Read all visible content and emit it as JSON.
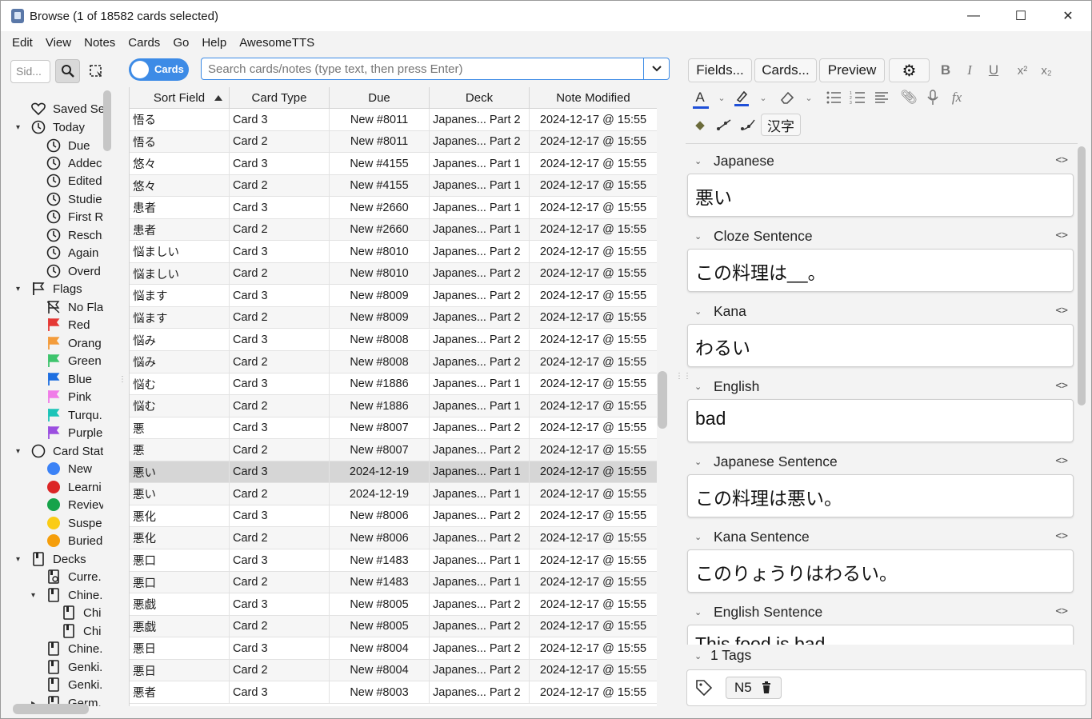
{
  "window": {
    "title": "Browse (1 of 18582 cards selected)",
    "minimize": "—",
    "maximize": "☐",
    "close": "✕"
  },
  "menu": [
    "Edit",
    "View",
    "Notes",
    "Cards",
    "Go",
    "Help",
    "AwesomeTTS"
  ],
  "sidebar": {
    "search_placeholder": "Sid...",
    "items": [
      {
        "label": "Saved Se",
        "icon": "heart-icon"
      },
      {
        "label": "Today",
        "icon": "clock-icon"
      },
      {
        "label": "Due",
        "icon": "clock-icon"
      },
      {
        "label": "Addec",
        "icon": "clock-icon"
      },
      {
        "label": "Edited",
        "icon": "clock-icon"
      },
      {
        "label": "Studie",
        "icon": "clock-icon"
      },
      {
        "label": "First R",
        "icon": "clock-icon"
      },
      {
        "label": "Resch.",
        "icon": "clock-icon"
      },
      {
        "label": "Again",
        "icon": "clock-icon"
      },
      {
        "label": "Overd",
        "icon": "clock-icon"
      },
      {
        "label": "Flags",
        "icon": "flag-icon"
      },
      {
        "label": "No Fla",
        "icon": "no-flag-icon"
      },
      {
        "label": "Red",
        "icon": "flag-icon",
        "color": "#e53935"
      },
      {
        "label": "Orang",
        "icon": "flag-icon",
        "color": "#f39c3c"
      },
      {
        "label": "Green",
        "icon": "flag-icon",
        "color": "#3ec46d"
      },
      {
        "label": "Blue",
        "icon": "flag-icon",
        "color": "#1e6fe0"
      },
      {
        "label": "Pink",
        "icon": "flag-icon",
        "color": "#f07ce8"
      },
      {
        "label": "Turqu.",
        "icon": "flag-icon",
        "color": "#1cc4b8"
      },
      {
        "label": "Purple",
        "icon": "flag-icon",
        "color": "#9b4fe0"
      },
      {
        "label": "Card Stat",
        "icon": "circle-icon"
      },
      {
        "label": "New",
        "icon": "dot-icon",
        "color": "#3b82f6"
      },
      {
        "label": "Learni",
        "icon": "dot-icon",
        "color": "#dc2626"
      },
      {
        "label": "Reviev",
        "icon": "dot-icon",
        "color": "#16a34a"
      },
      {
        "label": "Suspe",
        "icon": "dot-icon",
        "color": "#facc15"
      },
      {
        "label": "Buried",
        "icon": "dot-icon",
        "color": "#f59e0b"
      },
      {
        "label": "Decks",
        "icon": "deck-icon"
      },
      {
        "label": "Curre.",
        "icon": "current-deck-icon"
      },
      {
        "label": "Chine.",
        "icon": "deck-icon"
      },
      {
        "label": "Chi",
        "icon": "deck-icon"
      },
      {
        "label": "Chi",
        "icon": "deck-icon"
      },
      {
        "label": "Chine.",
        "icon": "deck-icon"
      },
      {
        "label": "Genki.",
        "icon": "deck-icon"
      },
      {
        "label": "Genki.",
        "icon": "deck-icon"
      },
      {
        "label": "Germ.",
        "icon": "deck-icon"
      }
    ]
  },
  "mode_toggle": {
    "label": "Cards"
  },
  "search": {
    "placeholder": "Search cards/notes (type text, then press Enter)"
  },
  "table": {
    "columns": [
      "Sort Field",
      "Card Type",
      "Due",
      "Deck",
      "Note Modified"
    ],
    "rows": [
      [
        "悟る",
        "Card 3",
        "New #8011",
        "Japanes... Part 2",
        "2024-12-17 @ 15:55"
      ],
      [
        "悟る",
        "Card 2",
        "New #8011",
        "Japanes... Part 2",
        "2024-12-17 @ 15:55"
      ],
      [
        "悠々",
        "Card 3",
        "New #4155",
        "Japanes... Part 1",
        "2024-12-17 @ 15:55"
      ],
      [
        "悠々",
        "Card 2",
        "New #4155",
        "Japanes... Part 1",
        "2024-12-17 @ 15:55"
      ],
      [
        "患者",
        "Card 3",
        "New #2660",
        "Japanes... Part 1",
        "2024-12-17 @ 15:55"
      ],
      [
        "患者",
        "Card 2",
        "New #2660",
        "Japanes... Part 1",
        "2024-12-17 @ 15:55"
      ],
      [
        "悩ましい",
        "Card 3",
        "New #8010",
        "Japanes... Part 2",
        "2024-12-17 @ 15:55"
      ],
      [
        "悩ましい",
        "Card 2",
        "New #8010",
        "Japanes... Part 2",
        "2024-12-17 @ 15:55"
      ],
      [
        "悩ます",
        "Card 3",
        "New #8009",
        "Japanes... Part 2",
        "2024-12-17 @ 15:55"
      ],
      [
        "悩ます",
        "Card 2",
        "New #8009",
        "Japanes... Part 2",
        "2024-12-17 @ 15:55"
      ],
      [
        "悩み",
        "Card 3",
        "New #8008",
        "Japanes... Part 2",
        "2024-12-17 @ 15:55"
      ],
      [
        "悩み",
        "Card 2",
        "New #8008",
        "Japanes... Part 2",
        "2024-12-17 @ 15:55"
      ],
      [
        "悩む",
        "Card 3",
        "New #1886",
        "Japanes... Part 1",
        "2024-12-17 @ 15:55"
      ],
      [
        "悩む",
        "Card 2",
        "New #1886",
        "Japanes... Part 1",
        "2024-12-17 @ 15:55"
      ],
      [
        "悪",
        "Card 3",
        "New #8007",
        "Japanes... Part 2",
        "2024-12-17 @ 15:55"
      ],
      [
        "悪",
        "Card 2",
        "New #8007",
        "Japanes... Part 2",
        "2024-12-17 @ 15:55"
      ],
      [
        "悪い",
        "Card 3",
        "2024-12-19",
        "Japanes... Part 1",
        "2024-12-17 @ 15:55"
      ],
      [
        "悪い",
        "Card 2",
        "2024-12-19",
        "Japanes... Part 1",
        "2024-12-17 @ 15:55"
      ],
      [
        "悪化",
        "Card 3",
        "New #8006",
        "Japanes... Part 2",
        "2024-12-17 @ 15:55"
      ],
      [
        "悪化",
        "Card 2",
        "New #8006",
        "Japanes... Part 2",
        "2024-12-17 @ 15:55"
      ],
      [
        "悪口",
        "Card 3",
        "New #1483",
        "Japanes... Part 1",
        "2024-12-17 @ 15:55"
      ],
      [
        "悪口",
        "Card 2",
        "New #1483",
        "Japanes... Part 1",
        "2024-12-17 @ 15:55"
      ],
      [
        "悪戯",
        "Card 3",
        "New #8005",
        "Japanes... Part 2",
        "2024-12-17 @ 15:55"
      ],
      [
        "悪戯",
        "Card 2",
        "New #8005",
        "Japanes... Part 2",
        "2024-12-17 @ 15:55"
      ],
      [
        "悪日",
        "Card 3",
        "New #8004",
        "Japanes... Part 2",
        "2024-12-17 @ 15:55"
      ],
      [
        "悪日",
        "Card 2",
        "New #8004",
        "Japanes... Part 2",
        "2024-12-17 @ 15:55"
      ],
      [
        "悪者",
        "Card 3",
        "New #8003",
        "Japanes... Part 2",
        "2024-12-17 @ 15:55"
      ]
    ],
    "selected_row": 16
  },
  "editor": {
    "buttons": {
      "fields": "Fields...",
      "cards": "Cards...",
      "preview": "Preview",
      "kanji": "汉字"
    },
    "fields": [
      {
        "name": "Japanese",
        "value": "悪い"
      },
      {
        "name": "Cloze Sentence",
        "value": "この料理は__。"
      },
      {
        "name": "Kana",
        "value": "わるい"
      },
      {
        "name": "English",
        "value": "bad"
      },
      {
        "name": "Japanese Sentence",
        "value": "この料理は悪い。"
      },
      {
        "name": "Kana Sentence",
        "value": "このりょうりはわるい。"
      },
      {
        "name": "English Sentence",
        "value": "This food is bad."
      }
    ],
    "tags_header": "1 Tags",
    "tags": [
      "N5"
    ],
    "text_color": "#1e4fd8",
    "highlight_color": "#1e4fd8"
  }
}
